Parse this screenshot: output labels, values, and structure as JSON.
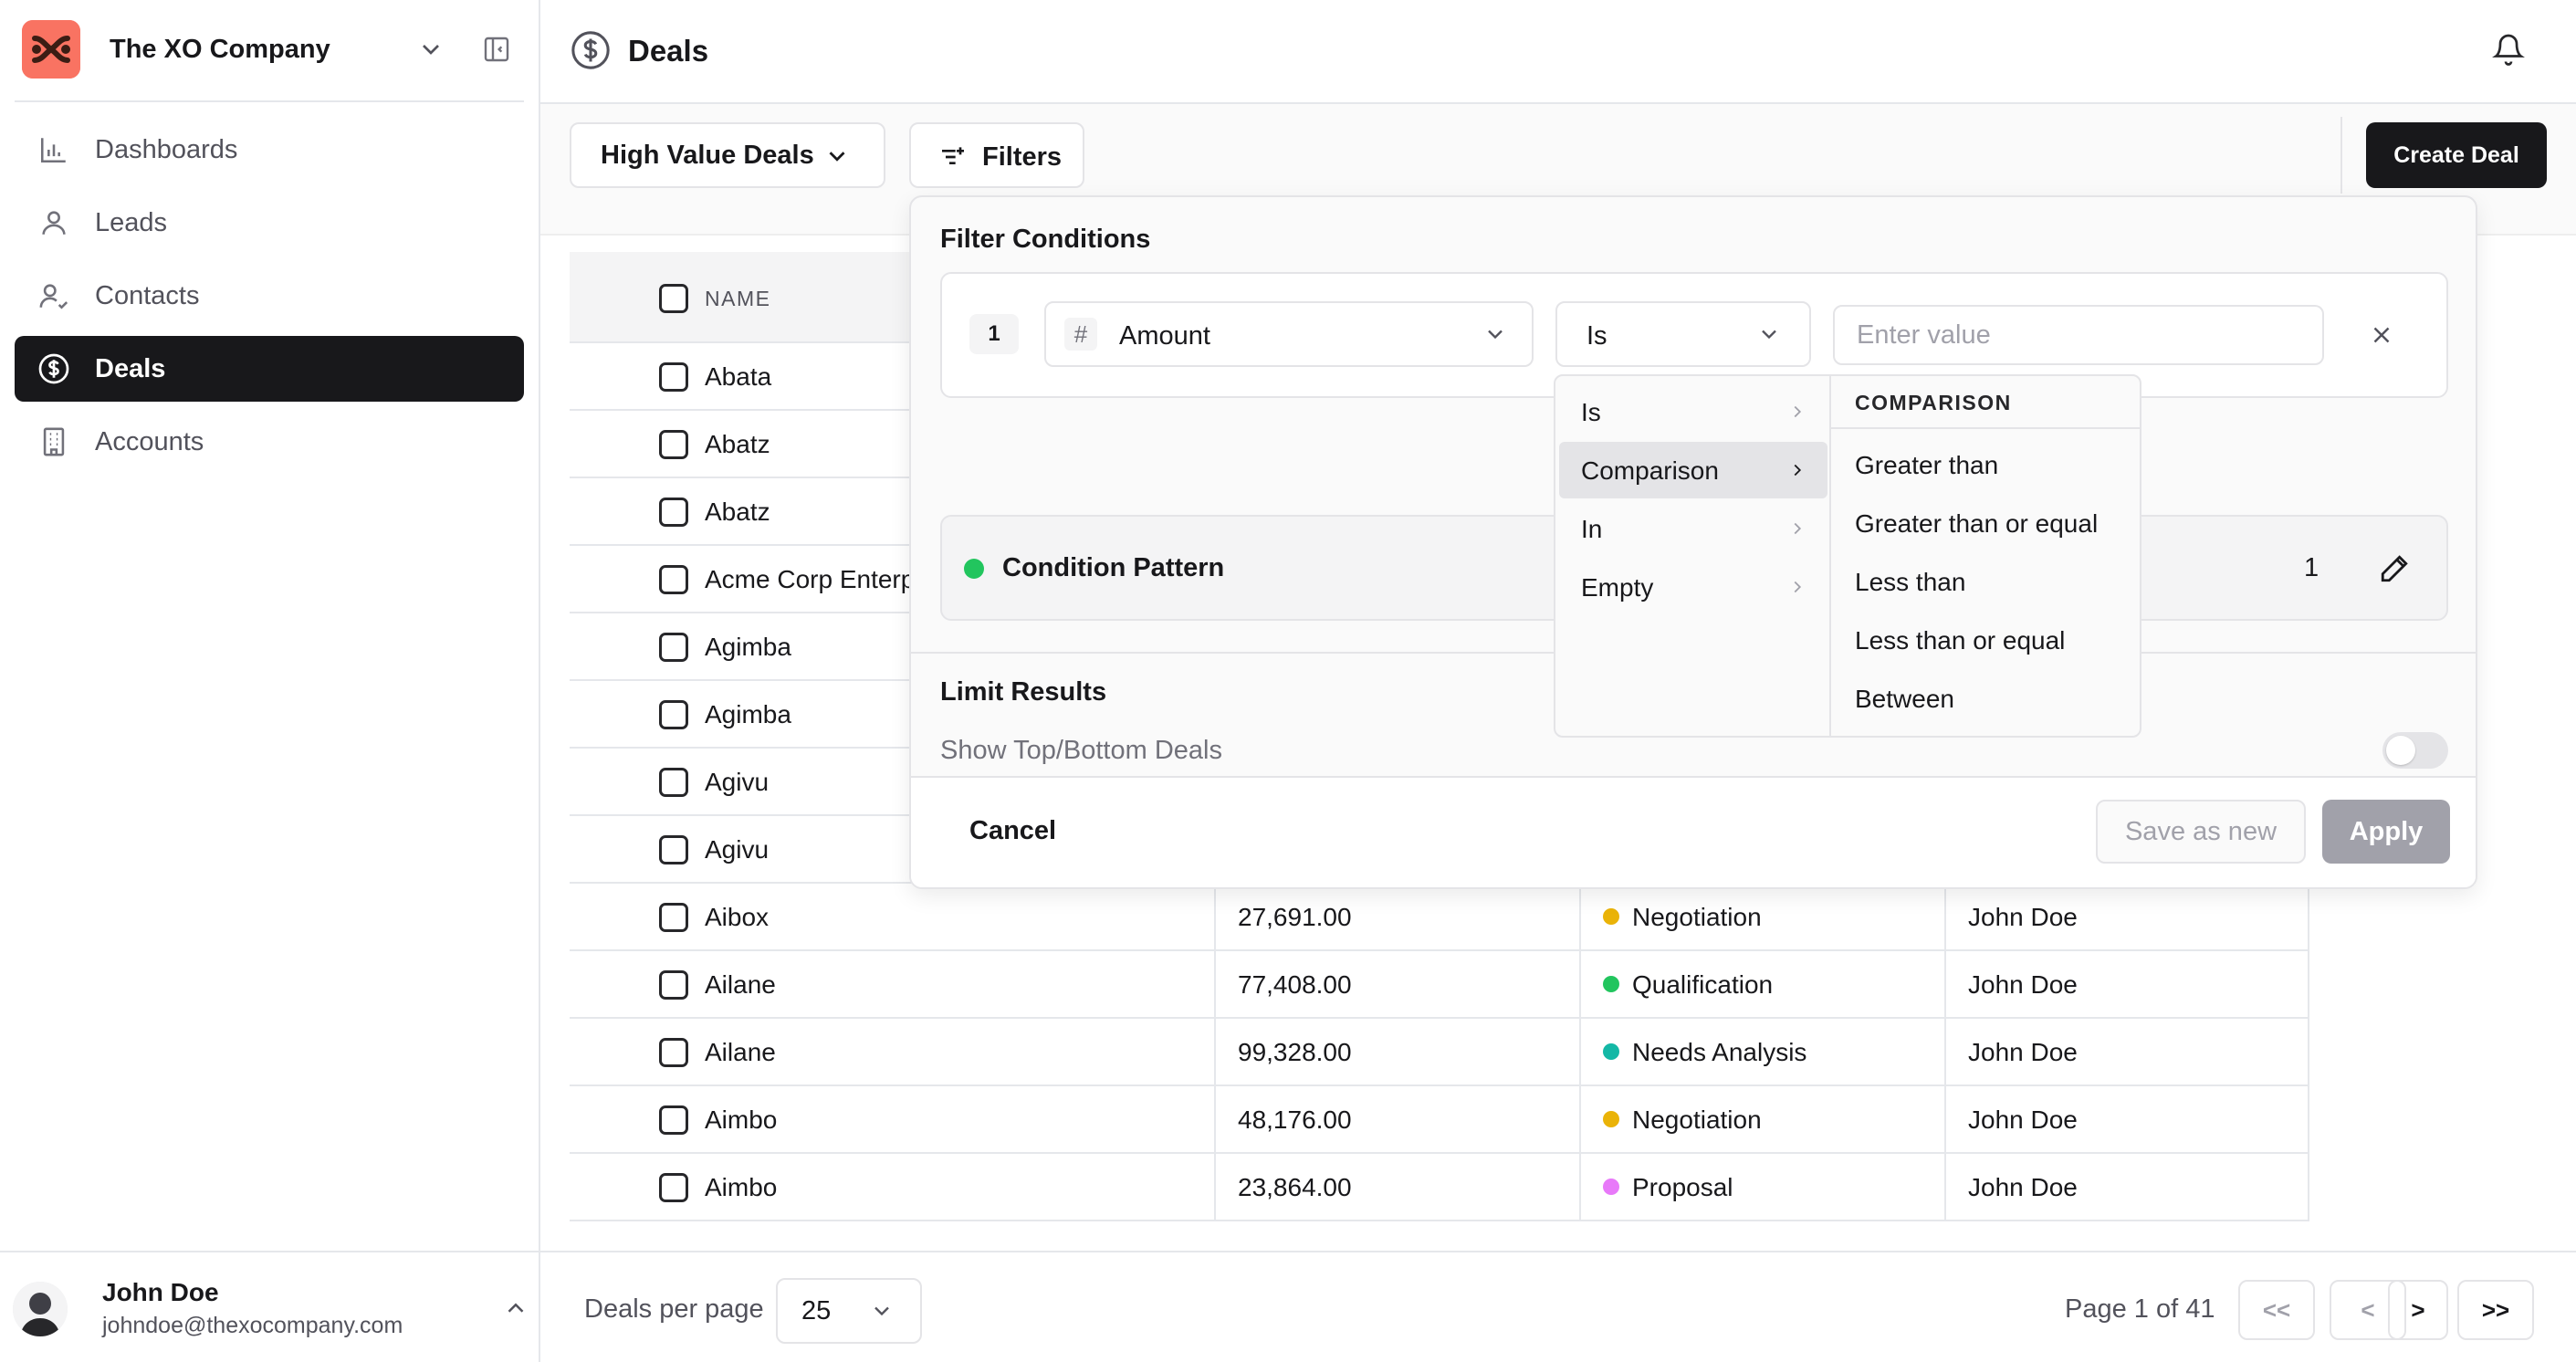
{
  "sidebar": {
    "company": "The XO Company",
    "items": [
      {
        "label": "Dashboards",
        "icon": "bar-chart-icon"
      },
      {
        "label": "Leads",
        "icon": "user-icon"
      },
      {
        "label": "Contacts",
        "icon": "user-check-icon"
      },
      {
        "label": "Deals",
        "icon": "dollar-circle-icon",
        "active": true
      },
      {
        "label": "Accounts",
        "icon": "building-icon"
      }
    ],
    "user": {
      "name": "John Doe",
      "email": "johndoe@thexocompany.com"
    }
  },
  "header": {
    "title": "Deals"
  },
  "toolbar": {
    "view": "High Value Deals",
    "filters_label": "Filters",
    "create_label": "Create Deal"
  },
  "table": {
    "name_header": "NAME",
    "rows": [
      {
        "name": "Abata"
      },
      {
        "name": "Abatz"
      },
      {
        "name": "Abatz"
      },
      {
        "name": "Acme Corp Enterprise"
      },
      {
        "name": "Agimba"
      },
      {
        "name": "Agimba"
      },
      {
        "name": "Agivu"
      },
      {
        "name": "Agivu"
      },
      {
        "name": "Aibox",
        "amount": "27,691.00",
        "stage": "Negotiation",
        "owner": "John Doe"
      },
      {
        "name": "Ailane",
        "amount": "77,408.00",
        "stage": "Qualification",
        "owner": "John Doe"
      },
      {
        "name": "Ailane",
        "amount": "99,328.00",
        "stage": "Needs Analysis",
        "owner": "John Doe"
      },
      {
        "name": "Aimbo",
        "amount": "48,176.00",
        "stage": "Negotiation",
        "owner": "John Doe"
      },
      {
        "name": "Aimbo",
        "amount": "23,864.00",
        "stage": "Proposal",
        "owner": "John Doe"
      }
    ],
    "stage_colors": {
      "Negotiation": "#eab308",
      "Qualification": "#22c55e",
      "Needs Analysis": "#14b8a6",
      "Proposal": "#e879f9"
    }
  },
  "footer": {
    "per_page_label": "Deals per page",
    "per_page": "25",
    "page_info": "Page 1 of 41",
    "buttons": [
      "<<",
      "<",
      ">",
      ">>"
    ]
  },
  "filter_panel": {
    "title": "Filter Conditions",
    "condition": {
      "number": "1",
      "field": "Amount",
      "operator": "Is",
      "value_placeholder": "Enter value"
    },
    "pattern_label": "Condition Pattern",
    "pattern_value": "1",
    "limit_title": "Limit Results",
    "limit_sub": "Show Top/Bottom Deals",
    "cancel": "Cancel",
    "save_as_new": "Save as new",
    "apply": "Apply"
  },
  "operator_menu": {
    "items": [
      "Is",
      "Comparison",
      "In",
      "Empty"
    ],
    "highlighted": "Comparison",
    "submenu_title": "COMPARISON",
    "submenu_items": [
      "Greater than",
      "Greater than or equal",
      "Less than",
      "Less than or equal",
      "Between"
    ]
  }
}
